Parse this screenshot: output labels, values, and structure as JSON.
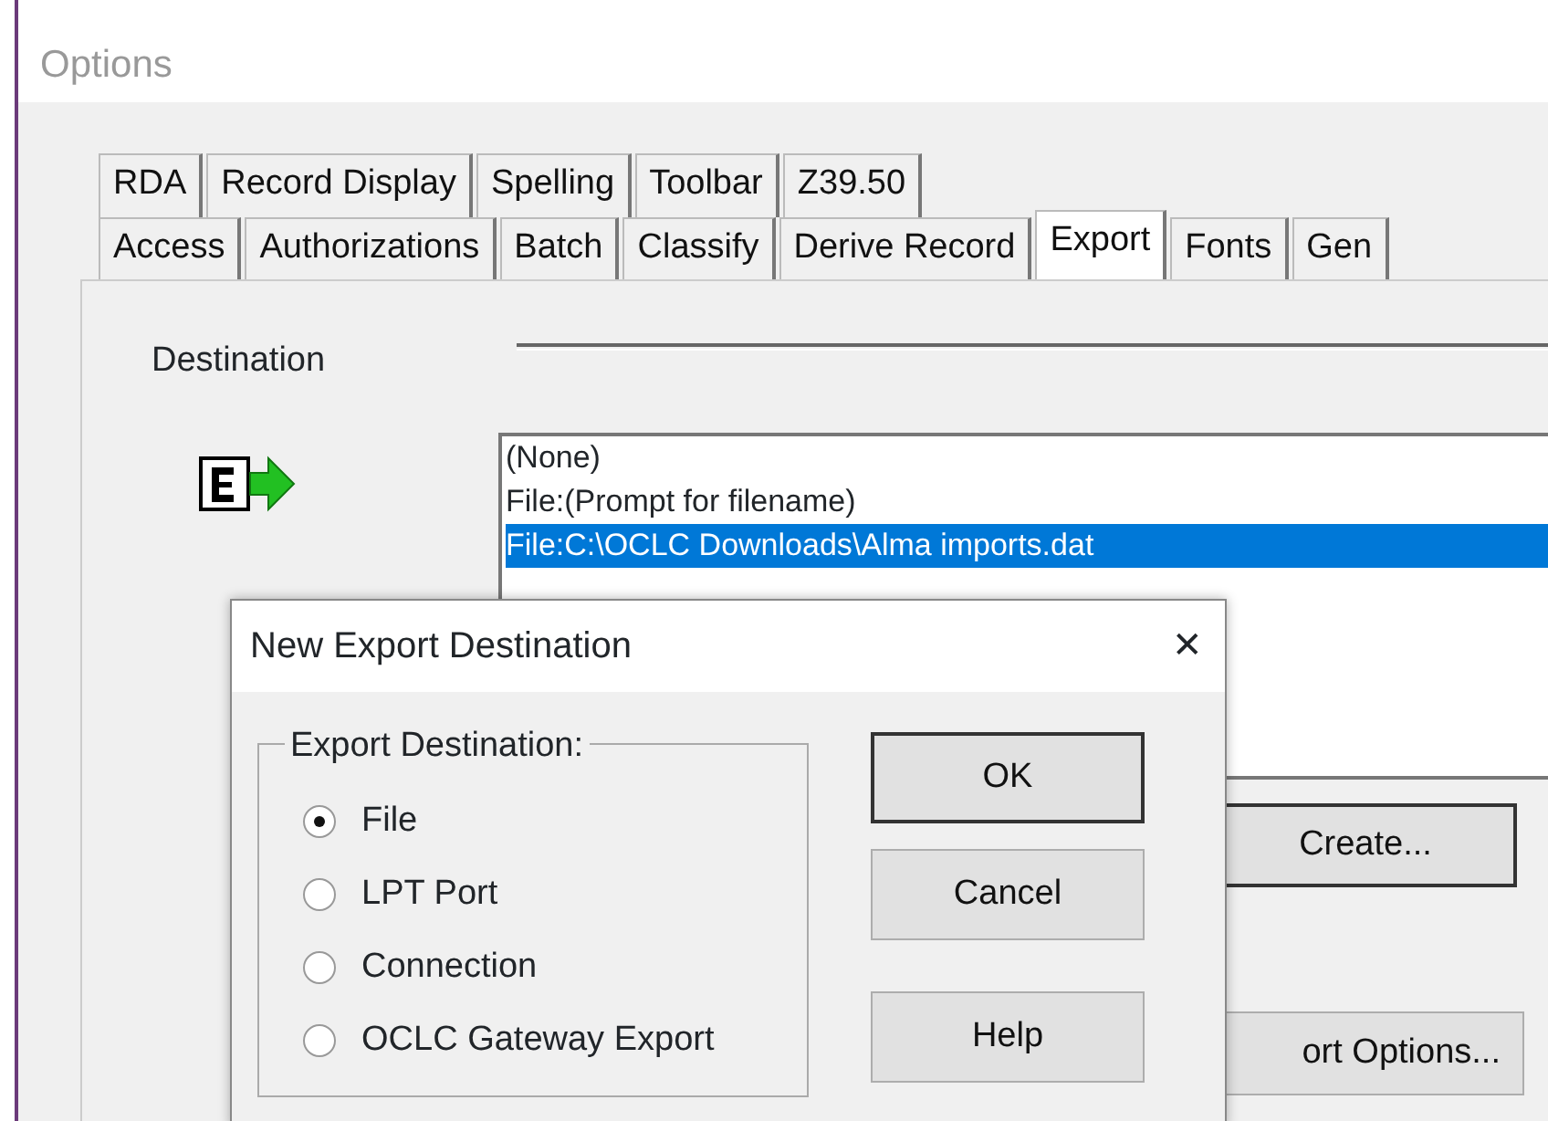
{
  "window": {
    "title": "Options"
  },
  "tab_rows": [
    [
      {
        "label": "RDA",
        "selected": false
      },
      {
        "label": "Record Display",
        "selected": false
      },
      {
        "label": "Spelling",
        "selected": false
      },
      {
        "label": "Toolbar",
        "selected": false
      },
      {
        "label": "Z39.50",
        "selected": false
      }
    ],
    [
      {
        "label": "Access",
        "selected": false
      },
      {
        "label": "Authorizations",
        "selected": false
      },
      {
        "label": "Batch",
        "selected": false
      },
      {
        "label": "Classify",
        "selected": false
      },
      {
        "label": "Derive Record",
        "selected": false
      },
      {
        "label": "Export",
        "selected": true
      },
      {
        "label": "Fonts",
        "selected": false
      },
      {
        "label": "Gen",
        "selected": false
      }
    ]
  ],
  "destination": {
    "label": "Destination",
    "items": [
      {
        "text": "(None)",
        "selected": false
      },
      {
        "text": "File:(Prompt for filename)",
        "selected": false
      },
      {
        "text": "File:C:\\OCLC Downloads\\Alma imports.dat",
        "selected": true
      }
    ],
    "create_button": "Create...",
    "options_button": "ort Options..."
  },
  "dialog": {
    "title": "New Export Destination",
    "close": "✕",
    "group_label": "Export Destination:",
    "options": [
      {
        "label": "File",
        "selected": true
      },
      {
        "label": "LPT Port",
        "selected": false
      },
      {
        "label": "Connection",
        "selected": false
      },
      {
        "label": "OCLC Gateway Export",
        "selected": false
      }
    ],
    "buttons": [
      "OK",
      "Cancel",
      "Help"
    ]
  }
}
